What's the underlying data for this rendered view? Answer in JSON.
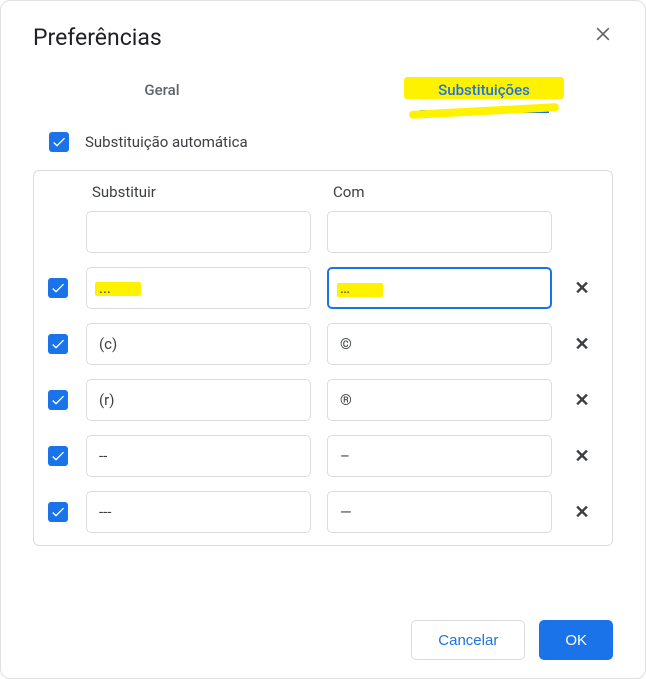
{
  "dialog": {
    "title": "Preferências",
    "close_label": "Fechar"
  },
  "tabs": {
    "general": "Geral",
    "substitutions": "Substituições"
  },
  "auto": {
    "label": "Substituição automática"
  },
  "columns": {
    "replace": "Substituir",
    "with": "Com"
  },
  "rows": [
    {
      "enabled": null,
      "replace": "",
      "with": "",
      "deletable": false,
      "focused": false,
      "hl_replace": false,
      "hl_with": false
    },
    {
      "enabled": true,
      "replace": "...",
      "with": "…",
      "deletable": true,
      "focused": true,
      "hl_replace": true,
      "hl_with": true
    },
    {
      "enabled": true,
      "replace": "(c)",
      "with": "©",
      "deletable": true,
      "focused": false,
      "hl_replace": false,
      "hl_with": false
    },
    {
      "enabled": true,
      "replace": "(r)",
      "with": "®",
      "deletable": true,
      "focused": false,
      "hl_replace": false,
      "hl_with": false
    },
    {
      "enabled": true,
      "replace": "--",
      "with": "–",
      "deletable": true,
      "focused": false,
      "hl_replace": false,
      "hl_with": false
    },
    {
      "enabled": true,
      "replace": "---",
      "with": "—",
      "deletable": true,
      "focused": false,
      "hl_replace": false,
      "hl_with": false
    }
  ],
  "footer": {
    "cancel": "Cancelar",
    "ok": "OK"
  }
}
